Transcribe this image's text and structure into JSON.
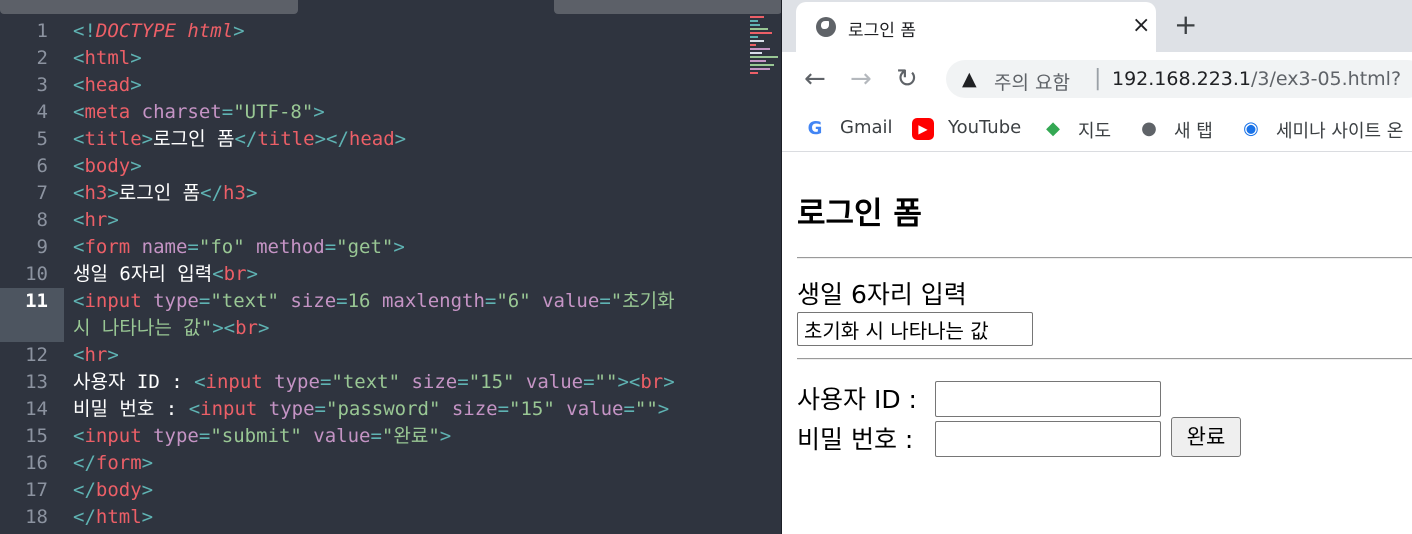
{
  "editor": {
    "active_line": 11,
    "line_numbers": [
      "1",
      "2",
      "3",
      "4",
      "5",
      "6",
      "7",
      "8",
      "9",
      "10",
      "11",
      "12",
      "13",
      "14",
      "15",
      "16",
      "17",
      "18"
    ],
    "lines": {
      "l1": {
        "a": "<!",
        "b": "DOCTYPE html",
        "c": ">"
      },
      "l2": {
        "a": "<",
        "b": "html",
        "c": ">"
      },
      "l3": {
        "a": "<",
        "b": "head",
        "c": ">"
      },
      "l4": {
        "a": "<",
        "b": "meta",
        "c": " charset",
        "d": "=",
        "e": "\"UTF-8\"",
        "f": ">"
      },
      "l5": {
        "a": "<",
        "b": "title",
        "c": ">",
        "d": "로그인 폼",
        "e": "</",
        "f": "title",
        "g": "></",
        "h": "head",
        "i": ">"
      },
      "l6": {
        "a": "<",
        "b": "body",
        "c": ">"
      },
      "l7": {
        "a": "<",
        "b": "h3",
        "c": ">",
        "d": "로그인 폼",
        "e": "</",
        "f": "h3",
        "g": ">"
      },
      "l8": {
        "a": "<",
        "b": "hr",
        "c": ">"
      },
      "l9": {
        "a": "<",
        "b": "form",
        "c": " name",
        "d": "=",
        "e": "\"fo\"",
        "f": " method",
        "g": "=",
        "h": "\"get\"",
        "i": ">"
      },
      "l10": {
        "a": "생일 6자리 입력",
        "b": "<",
        "c": "br",
        "d": ">"
      },
      "l11": {
        "a": "<",
        "b": "input",
        "c": " type",
        "d": "=",
        "e": "\"text\"",
        "f": " size",
        "g": "=",
        "h": "16",
        "i": " maxlength",
        "j": "=",
        "k": "\"6\"",
        "l": " value",
        "m": "=",
        "n": "\"초기화"
      },
      "l11b": {
        "a": "시 나타나는 값\"",
        "b": "><",
        "c": "br",
        "d": ">"
      },
      "l12": {
        "a": "<",
        "b": "hr",
        "c": ">"
      },
      "l13": {
        "a": "사용자 ID : ",
        "b": "<",
        "c": "input",
        "d": " type",
        "e": "=",
        "f": "\"text\"",
        "g": " size",
        "h": "=",
        "i": "\"15\"",
        "j": " value",
        "k": "=",
        "l": "\"\"",
        "m": "><",
        "n": "br",
        "o": ">"
      },
      "l14": {
        "a": "비밀 번호 : ",
        "b": "<",
        "c": "input",
        "d": " type",
        "e": "=",
        "f": "\"password\"",
        "g": " size",
        "h": "=",
        "i": "\"15\"",
        "j": " value",
        "k": "=",
        "l": "\"\"",
        "m": ">"
      },
      "l15": {
        "a": "<",
        "b": "input",
        "c": " type",
        "d": "=",
        "e": "\"submit\"",
        "f": " value",
        "g": "=",
        "h": "\"완료\"",
        "i": ">"
      },
      "l16": {
        "a": "</",
        "b": "form",
        "c": ">"
      },
      "l17": {
        "a": "</",
        "b": "body",
        "c": ">"
      },
      "l18": {
        "a": "</",
        "b": "html",
        "c": ">"
      }
    }
  },
  "browser": {
    "tab": {
      "title": "로그인 폼",
      "close": "×"
    },
    "new_tab": "+",
    "toolbar": {
      "back": "←",
      "forward": "→",
      "reload": "↻"
    },
    "omnibox": {
      "security_icon": "▲",
      "security_text": "주의 요함",
      "separator": "|",
      "host": "192.168.223.1",
      "path": "/3/ex3-05.html?"
    },
    "bookmarks": [
      {
        "icon": "G",
        "label": "Gmail",
        "icon_color": "#4285f4"
      },
      {
        "icon": "▶",
        "label": "YouTube",
        "icon_color": "#ff0000"
      },
      {
        "icon": "◆",
        "label": "지도",
        "icon_color": "#34a853"
      },
      {
        "icon": "●",
        "label": "새 탭",
        "icon_color": "#5f6368"
      },
      {
        "icon": "◉",
        "label": "세미나 사이트 온",
        "icon_color": "#1a73e8"
      }
    ],
    "page": {
      "heading": "로그인 폼",
      "birthday_label": "생일 6자리 입력",
      "birthday_value": "초기화 시 나타나는 값",
      "user_id_label": "사용자 ID :",
      "user_id_value": "",
      "password_label": "비밀 번호 :",
      "password_value": "",
      "submit_label": "완료"
    }
  },
  "colors": {
    "editor_bg": "#2f343f",
    "punct": "#5fb3b3",
    "tag": "#ec5f67",
    "attr": "#c594c5",
    "string": "#99c794",
    "text": "#ffffff"
  }
}
